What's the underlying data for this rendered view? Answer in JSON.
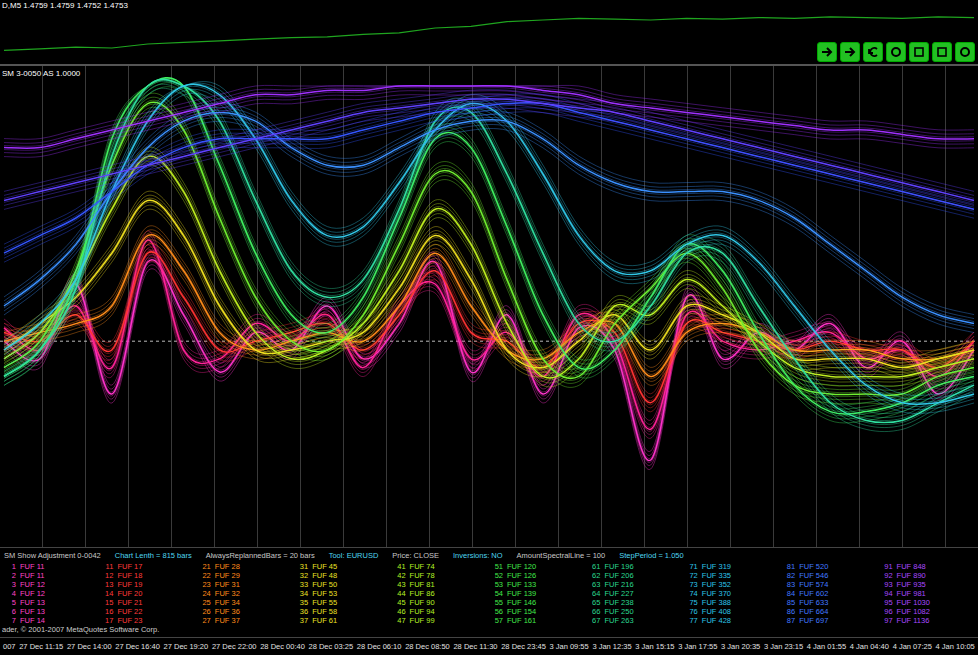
{
  "price_panel": {
    "title": "D,M5 1.4759 1.4759 1.4752 1.4753",
    "values": [
      1.4712,
      1.4714,
      1.4716,
      1.4715,
      1.472,
      1.4722,
      1.4724,
      1.4726,
      1.4728,
      1.4729,
      1.4732,
      1.4734,
      1.474,
      1.4742,
      1.4748,
      1.475,
      1.4752,
      1.4751,
      1.475,
      1.4752,
      1.4751,
      1.4753,
      1.4752,
      1.4754,
      1.4753,
      1.4752,
      1.4754,
      1.4753
    ],
    "axis_min": 1.47,
    "axis_max": 1.4765
  },
  "toolbar": {
    "buttons": [
      {
        "kind": "forward"
      },
      {
        "kind": "forward"
      },
      {
        "kind": "back"
      },
      {
        "kind": "circle"
      },
      {
        "kind": "box"
      },
      {
        "kind": "box"
      },
      {
        "kind": "circle"
      }
    ]
  },
  "indicator": {
    "title": "SM 3-0050 AS 1.0000",
    "midline": 42,
    "series": [
      {
        "color": "#ff33cc",
        "values": [
          42,
          38,
          55,
          30,
          60,
          48,
          35,
          44,
          40,
          50,
          38,
          46,
          60,
          35,
          48,
          30,
          45,
          40,
          15,
          52,
          38,
          44,
          40,
          46,
          36,
          42,
          30,
          40
        ]
      },
      {
        "color": "#ff2299",
        "values": [
          45,
          40,
          50,
          36,
          65,
          40,
          38,
          46,
          42,
          48,
          36,
          50,
          55,
          38,
          44,
          34,
          48,
          42,
          22,
          48,
          42,
          40,
          42,
          44,
          38,
          40,
          34,
          42
        ]
      },
      {
        "color": "#ff3333",
        "values": [
          44,
          42,
          48,
          40,
          62,
          52,
          40,
          42,
          44,
          46,
          40,
          48,
          58,
          44,
          42,
          36,
          46,
          44,
          28,
          46,
          44,
          42,
          40,
          42,
          40,
          40,
          36,
          42
        ]
      },
      {
        "color": "#ff8c1a",
        "values": [
          42,
          44,
          46,
          50,
          66,
          58,
          44,
          40,
          42,
          44,
          42,
          50,
          62,
          50,
          40,
          38,
          44,
          46,
          34,
          44,
          46,
          44,
          40,
          40,
          40,
          38,
          38,
          40
        ]
      },
      {
        "color": "#f0e020",
        "values": [
          40,
          46,
          52,
          62,
          74,
          66,
          50,
          40,
          40,
          42,
          44,
          54,
          66,
          56,
          40,
          36,
          42,
          48,
          40,
          50,
          48,
          44,
          38,
          38,
          38,
          36,
          38,
          40
        ]
      },
      {
        "color": "#c0f020",
        "values": [
          38,
          44,
          56,
          72,
          84,
          76,
          58,
          44,
          38,
          40,
          46,
          58,
          72,
          64,
          46,
          34,
          38,
          50,
          48,
          56,
          50,
          42,
          36,
          34,
          34,
          34,
          36,
          38
        ]
      },
      {
        "color": "#70f030",
        "values": [
          36,
          42,
          58,
          82,
          96,
          90,
          70,
          52,
          42,
          40,
          48,
          64,
          80,
          76,
          56,
          38,
          34,
          46,
          54,
          62,
          54,
          40,
          32,
          30,
          30,
          30,
          34,
          36
        ]
      },
      {
        "color": "#40f060",
        "values": [
          34,
          40,
          56,
          88,
          100,
          100,
          82,
          62,
          48,
          44,
          52,
          70,
          88,
          86,
          68,
          48,
          36,
          40,
          52,
          64,
          58,
          44,
          32,
          26,
          26,
          28,
          32,
          34
        ]
      },
      {
        "color": "#30e0a0",
        "values": [
          34,
          40,
          54,
          84,
          100,
          100,
          92,
          74,
          58,
          52,
          56,
          72,
          92,
          94,
          80,
          62,
          46,
          42,
          50,
          62,
          62,
          50,
          38,
          28,
          24,
          24,
          28,
          32
        ]
      },
      {
        "color": "#30c8e8",
        "values": [
          40,
          46,
          56,
          76,
          92,
          100,
          98,
          88,
          74,
          66,
          68,
          78,
          90,
          96,
          92,
          80,
          66,
          58,
          58,
          64,
          66,
          60,
          50,
          40,
          32,
          28,
          28,
          30
        ]
      },
      {
        "color": "#3a90ff",
        "values": [
          50,
          56,
          64,
          76,
          86,
          92,
          94,
          92,
          86,
          82,
          82,
          86,
          90,
          92,
          92,
          88,
          82,
          78,
          76,
          76,
          76,
          74,
          70,
          64,
          58,
          52,
          48,
          46
        ]
      },
      {
        "color": "#3355ff",
        "values": [
          62,
          66,
          70,
          76,
          82,
          86,
          88,
          88,
          88,
          88,
          90,
          92,
          94,
          95,
          96,
          96,
          94,
          92,
          90,
          88,
          86,
          84,
          82,
          80,
          78,
          76,
          74,
          72
        ]
      },
      {
        "color": "#6040ff",
        "values": [
          74,
          76,
          78,
          80,
          82,
          84,
          86,
          88,
          90,
          92,
          94,
          95,
          96,
          97,
          97,
          96,
          95,
          94,
          92,
          90,
          88,
          86,
          84,
          82,
          80,
          78,
          76,
          74
        ]
      },
      {
        "color": "#a030ff",
        "values": [
          86,
          86,
          88,
          90,
          92,
          94,
          96,
          98,
          98,
          99,
          99,
          100,
          100,
          100,
          100,
          99,
          98,
          96,
          95,
          94,
          93,
          92,
          91,
          90,
          90,
          89,
          88,
          88
        ]
      }
    ]
  },
  "info_bar": [
    "SM Show Adjustment 0-0042",
    "Chart Lenth = 815 bars",
    "AlwaysReplannedBars = 20 bars",
    "Tool: EURUSD",
    "Price: CLOSE",
    "Inversions: NO",
    "AmountSpectralLine = 100",
    "StepPeriod = 1.050"
  ],
  "legend": [
    {
      "color": "#ff44c8",
      "rows": [
        [
          "1",
          "FUF 11"
        ],
        [
          "2",
          "FUF 11"
        ],
        [
          "3",
          "FUF 12"
        ],
        [
          "4",
          "FUF 12"
        ],
        [
          "5",
          "FUF 13"
        ],
        [
          "6",
          "FUF 13"
        ],
        [
          "7",
          "FUF 14"
        ]
      ]
    },
    {
      "color": "#ff3a3a",
      "rows": [
        [
          "11",
          "FUF 17"
        ],
        [
          "12",
          "FUF 18"
        ],
        [
          "13",
          "FUF 19"
        ],
        [
          "14",
          "FUF 20"
        ],
        [
          "15",
          "FUF 21"
        ],
        [
          "16",
          "FUF 22"
        ],
        [
          "17",
          "FUF 23"
        ]
      ]
    },
    {
      "color": "#ff8c1a",
      "rows": [
        [
          "21",
          "FUF 28"
        ],
        [
          "22",
          "FUF 29"
        ],
        [
          "23",
          "FUF 31"
        ],
        [
          "24",
          "FUF 32"
        ],
        [
          "25",
          "FUF 34"
        ],
        [
          "26",
          "FUF 36"
        ],
        [
          "27",
          "FUF 37"
        ]
      ]
    },
    {
      "color": "#ece024",
      "rows": [
        [
          "31",
          "FUF 45"
        ],
        [
          "32",
          "FUF 48"
        ],
        [
          "33",
          "FUF 50"
        ],
        [
          "34",
          "FUF 53"
        ],
        [
          "35",
          "FUF 55"
        ],
        [
          "36",
          "FUF 58"
        ],
        [
          "37",
          "FUF 61"
        ]
      ]
    },
    {
      "color": "#b4f024",
      "rows": [
        [
          "41",
          "FUF 74"
        ],
        [
          "42",
          "FUF 78"
        ],
        [
          "43",
          "FUF 81"
        ],
        [
          "44",
          "FUF 86"
        ],
        [
          "45",
          "FUF 90"
        ],
        [
          "46",
          "FUF 94"
        ],
        [
          "47",
          "FUF 99"
        ]
      ]
    },
    {
      "color": "#40e84a",
      "rows": [
        [
          "51",
          "FUF 120"
        ],
        [
          "52",
          "FUF 126"
        ],
        [
          "53",
          "FUF 133"
        ],
        [
          "54",
          "FUF 139"
        ],
        [
          "55",
          "FUF 146"
        ],
        [
          "56",
          "FUF 154"
        ],
        [
          "57",
          "FUF 161"
        ]
      ]
    },
    {
      "color": "#2ad890",
      "rows": [
        [
          "61",
          "FUF 196"
        ],
        [
          "62",
          "FUF 206"
        ],
        [
          "63",
          "FUF 216"
        ],
        [
          "64",
          "FUF 227"
        ],
        [
          "65",
          "FUF 238"
        ],
        [
          "66",
          "FUF 250"
        ],
        [
          "67",
          "FUF 263"
        ]
      ]
    },
    {
      "color": "#2cc4e8",
      "rows": [
        [
          "71",
          "FUF 319"
        ],
        [
          "72",
          "FUF 335"
        ],
        [
          "73",
          "FUF 352"
        ],
        [
          "74",
          "FUF 370"
        ],
        [
          "75",
          "FUF 388"
        ],
        [
          "76",
          "FUF 408"
        ],
        [
          "77",
          "FUF 428"
        ]
      ]
    },
    {
      "color": "#4078ff",
      "rows": [
        [
          "81",
          "FUF 520"
        ],
        [
          "82",
          "FUF 546"
        ],
        [
          "83",
          "FUF 574"
        ],
        [
          "84",
          "FUF 602"
        ],
        [
          "85",
          "FUF 633"
        ],
        [
          "86",
          "FUF 664"
        ],
        [
          "87",
          "FUF 697"
        ]
      ]
    },
    {
      "color": "#a848ff",
      "rows": [
        [
          "91",
          "FUF 848"
        ],
        [
          "92",
          "FUF 890"
        ],
        [
          "93",
          "FUF 935"
        ],
        [
          "94",
          "FUF 981"
        ],
        [
          "95",
          "FUF 1030"
        ],
        [
          "96",
          "FUF 1082"
        ],
        [
          "97",
          "FUF 1136"
        ]
      ]
    }
  ],
  "copyright": "ader, © 2001-2007 MetaQuotes Software Corp.",
  "time_axis": [
    "007",
    "27 Dec 11:15",
    "27 Dec 14:00",
    "27 Dec 16:40",
    "27 Dec 19:20",
    "27 Dec 22:00",
    "28 Dec 00:40",
    "28 Dec 03:25",
    "28 Dec 06:10",
    "28 Dec 08:50",
    "28 Dec 11:30",
    "28 Dec 23:45",
    "3 Jan 09:55",
    "3 Jan 12:35",
    "3 Jan 15:15",
    "3 Jan 17:55",
    "3 Jan 20:35",
    "3 Jan 23:15",
    "4 Jan 01:55",
    "4 Jan 04:40",
    "4 Jan 07:25",
    "4 Jan 10:05"
  ]
}
